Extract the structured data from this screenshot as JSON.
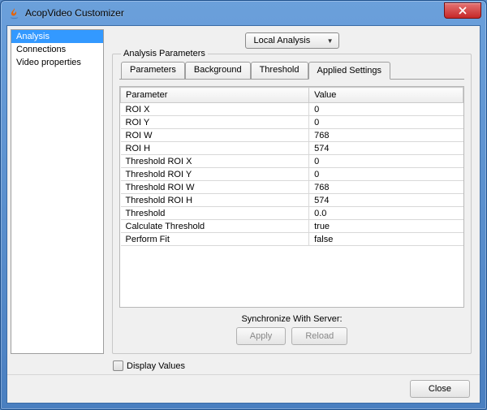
{
  "window": {
    "title": "AcopVideo Customizer"
  },
  "sidebar": {
    "items": [
      {
        "label": "Analysis",
        "selected": true
      },
      {
        "label": "Connections",
        "selected": false
      },
      {
        "label": "Video properties",
        "selected": false
      }
    ]
  },
  "combo": {
    "label": "Local Analysis"
  },
  "fieldset": {
    "legend": "Analysis Parameters"
  },
  "tabs": [
    {
      "label": "Parameters",
      "active": false
    },
    {
      "label": "Background",
      "active": false
    },
    {
      "label": "Threshold",
      "active": false
    },
    {
      "label": "Applied Settings",
      "active": true
    }
  ],
  "table": {
    "headers": {
      "col1": "Parameter",
      "col2": "Value"
    },
    "rows": [
      {
        "param": "ROI X",
        "value": "0"
      },
      {
        "param": "ROI Y",
        "value": "0"
      },
      {
        "param": "ROI W",
        "value": "768"
      },
      {
        "param": "ROI H",
        "value": "574"
      },
      {
        "param": "Threshold ROI X",
        "value": "0"
      },
      {
        "param": "Threshold ROI Y",
        "value": "0"
      },
      {
        "param": "Threshold ROI W",
        "value": "768"
      },
      {
        "param": "Threshold ROI H",
        "value": "574"
      },
      {
        "param": "Threshold",
        "value": "0.0"
      },
      {
        "param": "Calculate Threshold",
        "value": "true"
      },
      {
        "param": "Perform Fit",
        "value": "false"
      }
    ]
  },
  "sync": {
    "label": "Synchronize With Server:",
    "apply": "Apply",
    "reload": "Reload"
  },
  "display_values": {
    "label": "Display Values",
    "checked": false
  },
  "footer": {
    "close": "Close"
  }
}
